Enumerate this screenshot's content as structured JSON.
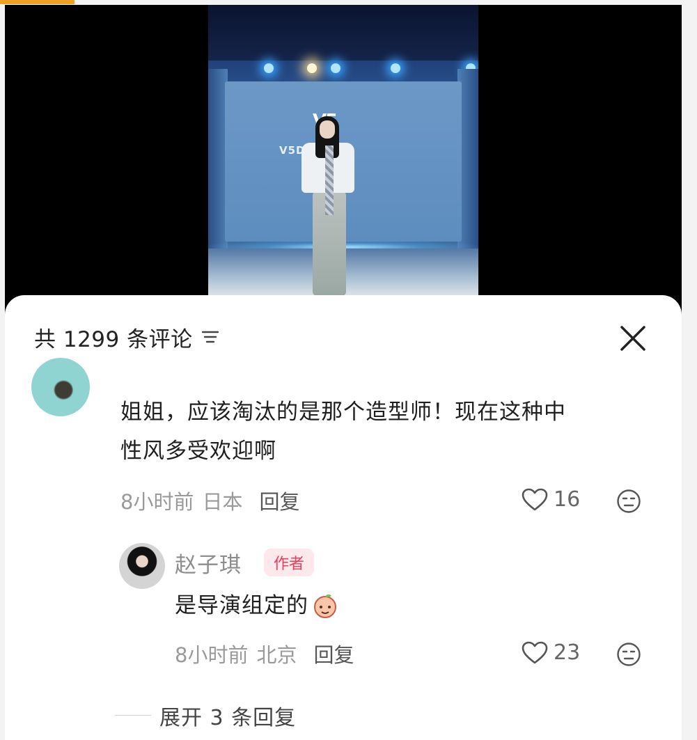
{
  "panel": {
    "comment_count_label": "共 1299 条评论"
  },
  "video": {
    "studio_label": "V5D      TUDIO",
    "logo": "V5"
  },
  "comments": [
    {
      "text_line1": "姐姐，应该淘汰的是那个造型师！现在这种中",
      "text_line2": "性风多受欢迎啊",
      "time": "8小时前",
      "location": "日本",
      "reply_label": "回复",
      "likes": "16"
    }
  ],
  "reply": {
    "author": "赵子琪",
    "badge": "作者",
    "text": "是导演组定的",
    "time": "8小时前",
    "location": "北京",
    "reply_label": "回复",
    "likes": "23"
  },
  "expand_replies_label": "展开 3 条回复",
  "colors": {
    "accent": "#f0a023",
    "badge_text": "#e6405a",
    "badge_bg": "#fde8ec"
  }
}
